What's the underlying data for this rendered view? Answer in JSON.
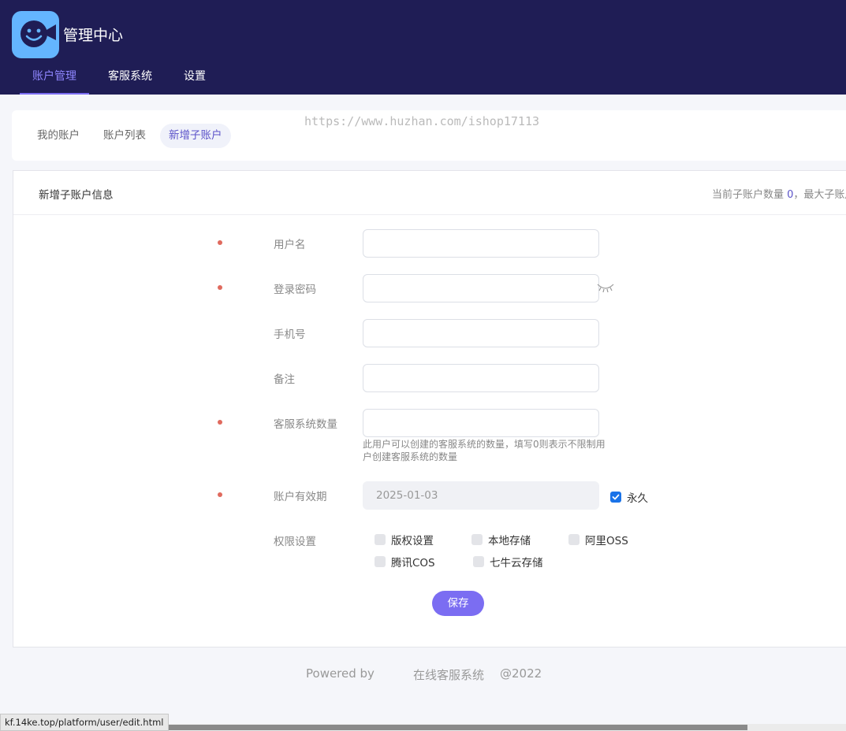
{
  "app": {
    "title": "管理中心"
  },
  "nav": {
    "items": [
      "账户管理",
      "客服系统",
      "设置"
    ]
  },
  "subtabs": {
    "items": [
      "我的账户",
      "账户列表",
      "新增子账户"
    ]
  },
  "watermark": "https://www.huzhan.com/ishop17113",
  "card": {
    "title": "新增子账户信息",
    "info_prefix": "当前子账户数量 ",
    "current_count": "0",
    "info_suffix": "，最大子账户"
  },
  "form": {
    "username_label": "用户名",
    "password_label": "登录密码",
    "phone_label": "手机号",
    "remark_label": "备注",
    "service_count_label": "客服系统数量",
    "service_count_hint": "此用户可以创建的客服系统的数量，填写0则表示不限制用户创建客服系统的数量",
    "expiry_label": "账户有效期",
    "expiry_value": "2025-01-03",
    "forever_label": "永久",
    "permissions_label": "权限设置",
    "permissions": [
      "版权设置",
      "本地存储",
      "阿里OSS",
      "腾讯COS",
      "七牛云存储"
    ],
    "save_label": "保存"
  },
  "footer": {
    "powered_by": "Powered by",
    "system_name": "在线客服系统",
    "year": "@2022"
  },
  "status_url": "kf.14ke.top/platform/user/edit.html",
  "colors": {
    "header_bg": "#1f1d55",
    "accent": "#7b6df2",
    "required": "#e06a5e",
    "checkbox_on": "#1a73e8"
  }
}
